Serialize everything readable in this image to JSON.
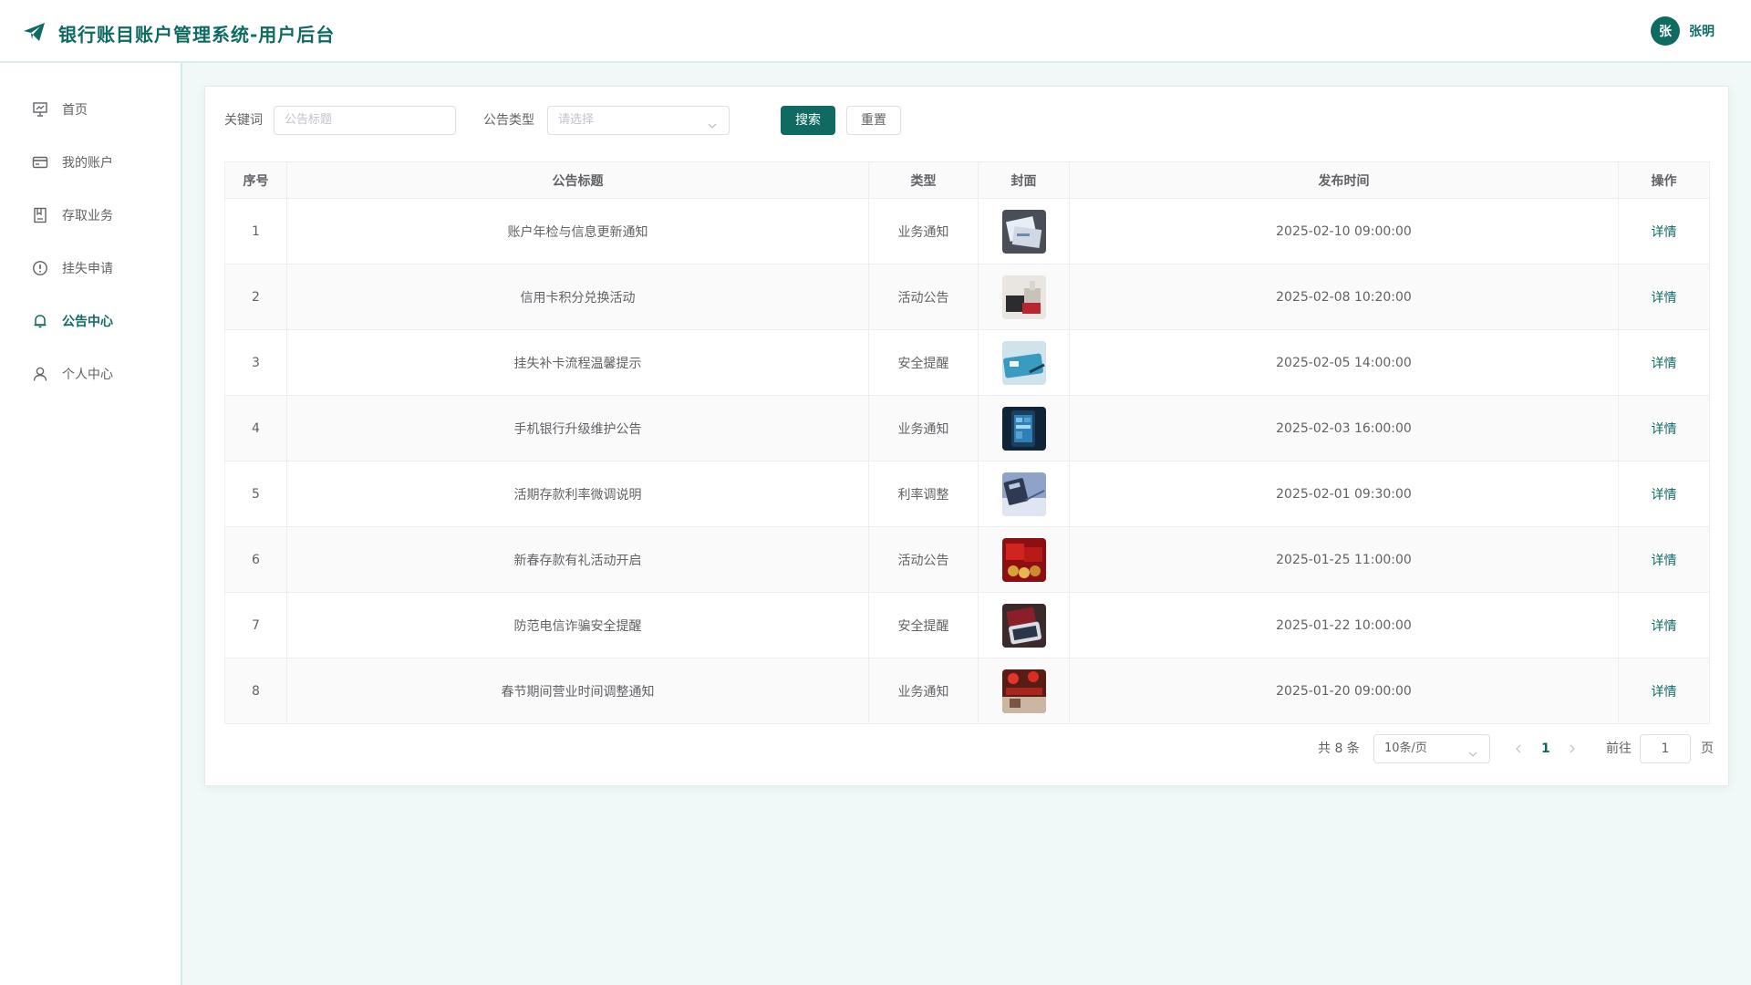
{
  "header": {
    "title": "银行账目账户管理系统-用户后台",
    "user_avatar_text": "张",
    "user_name": "张明"
  },
  "sidebar": {
    "items": [
      {
        "label": "首页",
        "icon": "presentation-icon",
        "active": false
      },
      {
        "label": "我的账户",
        "icon": "credit-card-icon",
        "active": false
      },
      {
        "label": "存取业务",
        "icon": "bookmark-book-icon",
        "active": false
      },
      {
        "label": "挂失申请",
        "icon": "warning-circle-icon",
        "active": false
      },
      {
        "label": "公告中心",
        "icon": "bell-icon",
        "active": true
      },
      {
        "label": "个人中心",
        "icon": "user-icon",
        "active": false
      }
    ]
  },
  "filters": {
    "keyword_label": "关键词",
    "keyword_placeholder": "公告标题",
    "keyword_value": "",
    "type_label": "公告类型",
    "type_placeholder": "请选择",
    "search_label": "搜索",
    "reset_label": "重置"
  },
  "table": {
    "headers": [
      "序号",
      "公告标题",
      "类型",
      "封面",
      "发布时间",
      "操作"
    ],
    "rows": [
      {
        "no": "1",
        "title": "账户年检与信息更新通知",
        "type": "业务通知",
        "time": "2025-02-10 09:00:00",
        "action": "详情",
        "cover": "documents-photo"
      },
      {
        "no": "2",
        "title": "信用卡积分兑换活动",
        "type": "活动公告",
        "time": "2025-02-08 10:20:00",
        "action": "详情",
        "cover": "gift-boxes-photo"
      },
      {
        "no": "3",
        "title": "挂失补卡流程温馨提示",
        "type": "安全提醒",
        "time": "2025-02-05 14:00:00",
        "action": "详情",
        "cover": "bank-card-photo"
      },
      {
        "no": "4",
        "title": "手机银行升级维护公告",
        "type": "业务通知",
        "time": "2025-02-03 16:00:00",
        "action": "详情",
        "cover": "smartphone-photo"
      },
      {
        "no": "5",
        "title": "活期存款利率微调说明",
        "type": "利率调整",
        "time": "2025-02-01 09:30:00",
        "action": "详情",
        "cover": "calculator-photo"
      },
      {
        "no": "6",
        "title": "新春存款有礼活动开启",
        "type": "活动公告",
        "time": "2025-01-25 11:00:00",
        "action": "详情",
        "cover": "red-gifts-photo"
      },
      {
        "no": "7",
        "title": "防范电信诈骗安全提醒",
        "type": "安全提醒",
        "time": "2025-01-22 10:00:00",
        "action": "详情",
        "cover": "phone-card-photo"
      },
      {
        "no": "8",
        "title": "春节期间营业时间调整通知",
        "type": "业务通知",
        "time": "2025-01-20 09:00:00",
        "action": "详情",
        "cover": "lanterns-photo"
      }
    ]
  },
  "pagination": {
    "total_text": "共 8 条",
    "page_size": "10条/页",
    "current_page": "1",
    "goto_label": "前往",
    "goto_value": "1",
    "page_suffix": "页"
  },
  "colors": {
    "accent": "#0f6b62",
    "background": "#f0f9f8"
  }
}
